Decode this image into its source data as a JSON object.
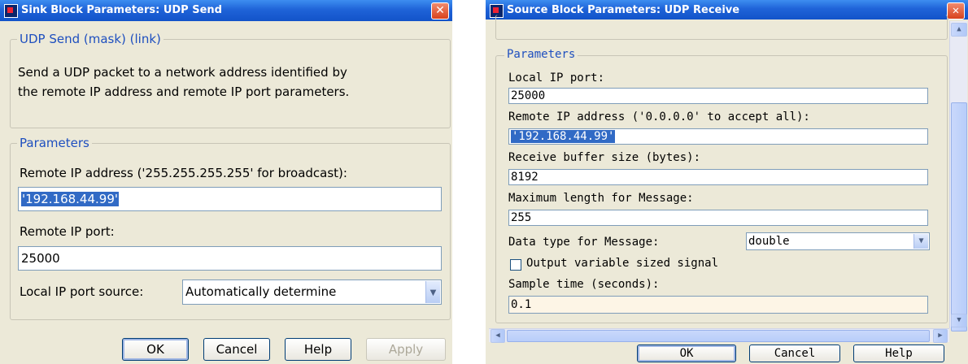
{
  "sink": {
    "title": "Sink Block Parameters: UDP Send",
    "close": "✕",
    "mask_legend": "UDP Send (mask) (link)",
    "description_line1": "Send a UDP packet to a network address identified by",
    "description_line2": "the remote IP address and remote IP port parameters.",
    "params_legend": "Parameters",
    "remote_ip_label": "Remote IP address ('255.255.255.255' for broadcast):",
    "remote_ip_value": "'192.168.44.99'",
    "remote_port_label": "Remote IP port:",
    "remote_port_value": "25000",
    "local_port_source_label": "Local IP port source:",
    "local_port_source_value": "Automatically determine",
    "buttons": {
      "ok": "OK",
      "cancel": "Cancel",
      "help": "Help",
      "apply": "Apply"
    }
  },
  "source": {
    "title": "Source Block Parameters: UDP Receive",
    "close": "✕",
    "params_legend": "Parameters",
    "local_port_label": "Local IP port:",
    "local_port_value": "25000",
    "remote_ip_label": "Remote IP address ('0.0.0.0' to accept all):",
    "remote_ip_value": "'192.168.44.99'",
    "buffer_label": "Receive buffer size (bytes):",
    "buffer_value": "8192",
    "maxlen_label": "Maximum length for Message:",
    "maxlen_value": "255",
    "datatype_label": "Data type for Message:",
    "datatype_value": "double",
    "varsize_label": "Output variable sized signal",
    "varsize_checked": false,
    "sample_label": "Sample time (seconds):",
    "sample_value": "0.1",
    "buttons": {
      "ok": "OK",
      "cancel": "Cancel",
      "help": "Help"
    }
  },
  "icons": [
    "app-icon",
    "close-icon",
    "chevron-down-icon",
    "scroll-up-icon",
    "scroll-down-icon",
    "scroll-left-icon",
    "scroll-right-icon"
  ]
}
